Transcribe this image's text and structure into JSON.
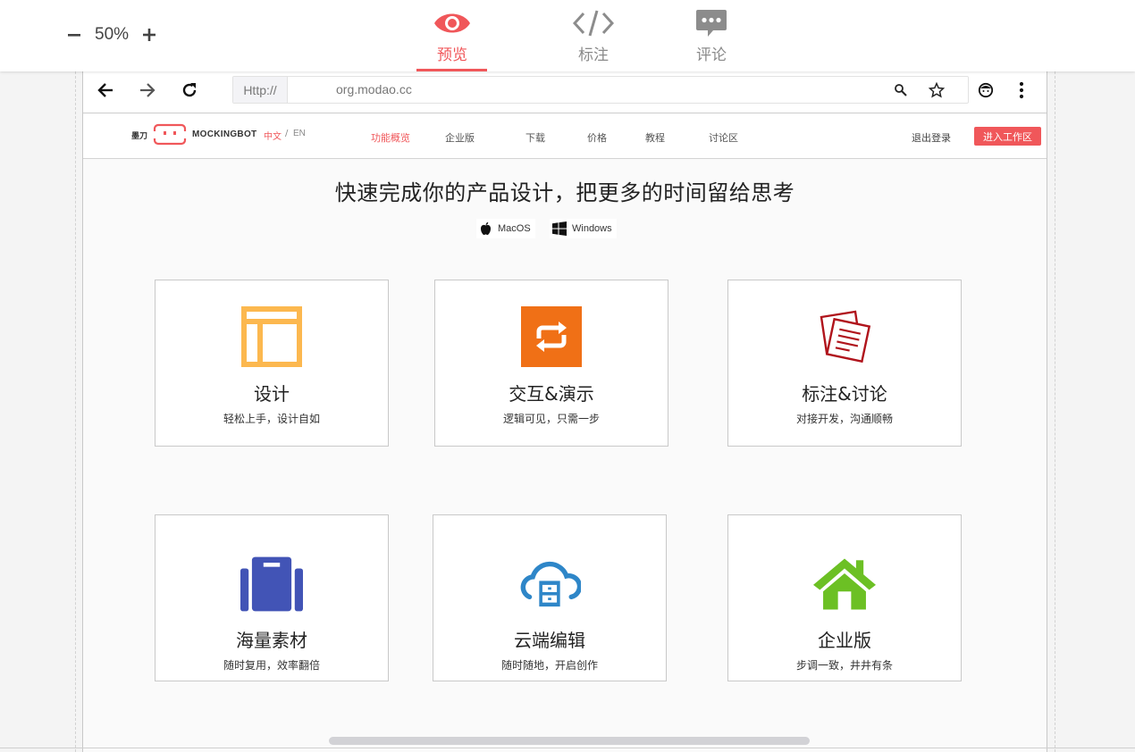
{
  "toolbar": {
    "zoom_value": "50%",
    "tabs": [
      {
        "label": "预览",
        "icon": "eye-icon",
        "active": true
      },
      {
        "label": "标注",
        "icon": "code-icon",
        "active": false
      },
      {
        "label": "评论",
        "icon": "comment-icon",
        "active": false
      }
    ],
    "accent": "#f0575a"
  },
  "browser": {
    "url_protocol": "Http://",
    "url": "org.modao.cc"
  },
  "site": {
    "logo_cn": "墨刀",
    "logo_text": "MOCKINGBOT",
    "lang_zh": "中文",
    "lang_sep": "/",
    "lang_en": "EN",
    "nav": [
      "功能概览",
      "企业版",
      "下载",
      "价格",
      "教程",
      "讨论区"
    ],
    "logout": "退出登录",
    "enter": "进入工作区"
  },
  "hero": {
    "title": "快速完成你的产品设计，把更多的时间留给思考",
    "platforms": [
      "MacOS",
      "Windows"
    ]
  },
  "features": [
    {
      "title": "设计",
      "subtitle": "轻松上手，设计自如",
      "icon": "layout-icon",
      "color": "#fcb84f"
    },
    {
      "title": "交互&演示",
      "subtitle": "逻辑可见，只需一步",
      "icon": "swap-icon",
      "color": "#f07016"
    },
    {
      "title": "标注&讨论",
      "subtitle": "对接开发，沟通顺畅",
      "icon": "notes-icon",
      "color": "#b0141c"
    },
    {
      "title": "海量素材",
      "subtitle": "随时复用，效率翻倍",
      "icon": "briefcase-icon",
      "color": "#4254b6"
    },
    {
      "title": "云端编辑",
      "subtitle": "随时随地，开启创作",
      "icon": "cloud-icon",
      "color": "#2e86c8"
    },
    {
      "title": "企业版",
      "subtitle": "步调一致，井井有条",
      "icon": "house-icon",
      "color": "#6cc024"
    }
  ]
}
